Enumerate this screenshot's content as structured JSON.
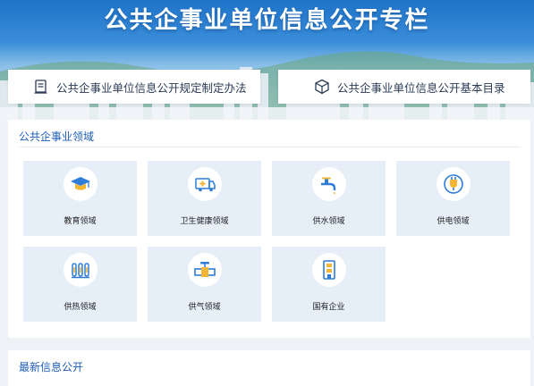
{
  "banner": {
    "title": "公共企事业单位信息公开专栏",
    "links": [
      {
        "label": "公共企事业单位信息公开规定制定办法",
        "icon": "document-icon"
      },
      {
        "label": "公共企事业单位信息公开基本目录",
        "icon": "cube-icon"
      }
    ]
  },
  "domains": {
    "title": "公共企事业领域",
    "items": [
      {
        "label": "教育领域",
        "icon": "graduation-cap-icon"
      },
      {
        "label": "卫生健康领域",
        "icon": "ambulance-icon"
      },
      {
        "label": "供水领域",
        "icon": "water-tap-icon"
      },
      {
        "label": "供电领域",
        "icon": "plug-icon"
      },
      {
        "label": "供热领域",
        "icon": "radiator-icon"
      },
      {
        "label": "供气领域",
        "icon": "gas-valve-icon"
      },
      {
        "label": "国有企业",
        "icon": "building-icon"
      }
    ]
  },
  "latest": {
    "title": "最新信息公开"
  },
  "colors": {
    "accent": "#1f5fb8",
    "tile_bg": "#e6eef8",
    "icon_blue": "#2e7dd8",
    "icon_gold": "#f2b534"
  }
}
